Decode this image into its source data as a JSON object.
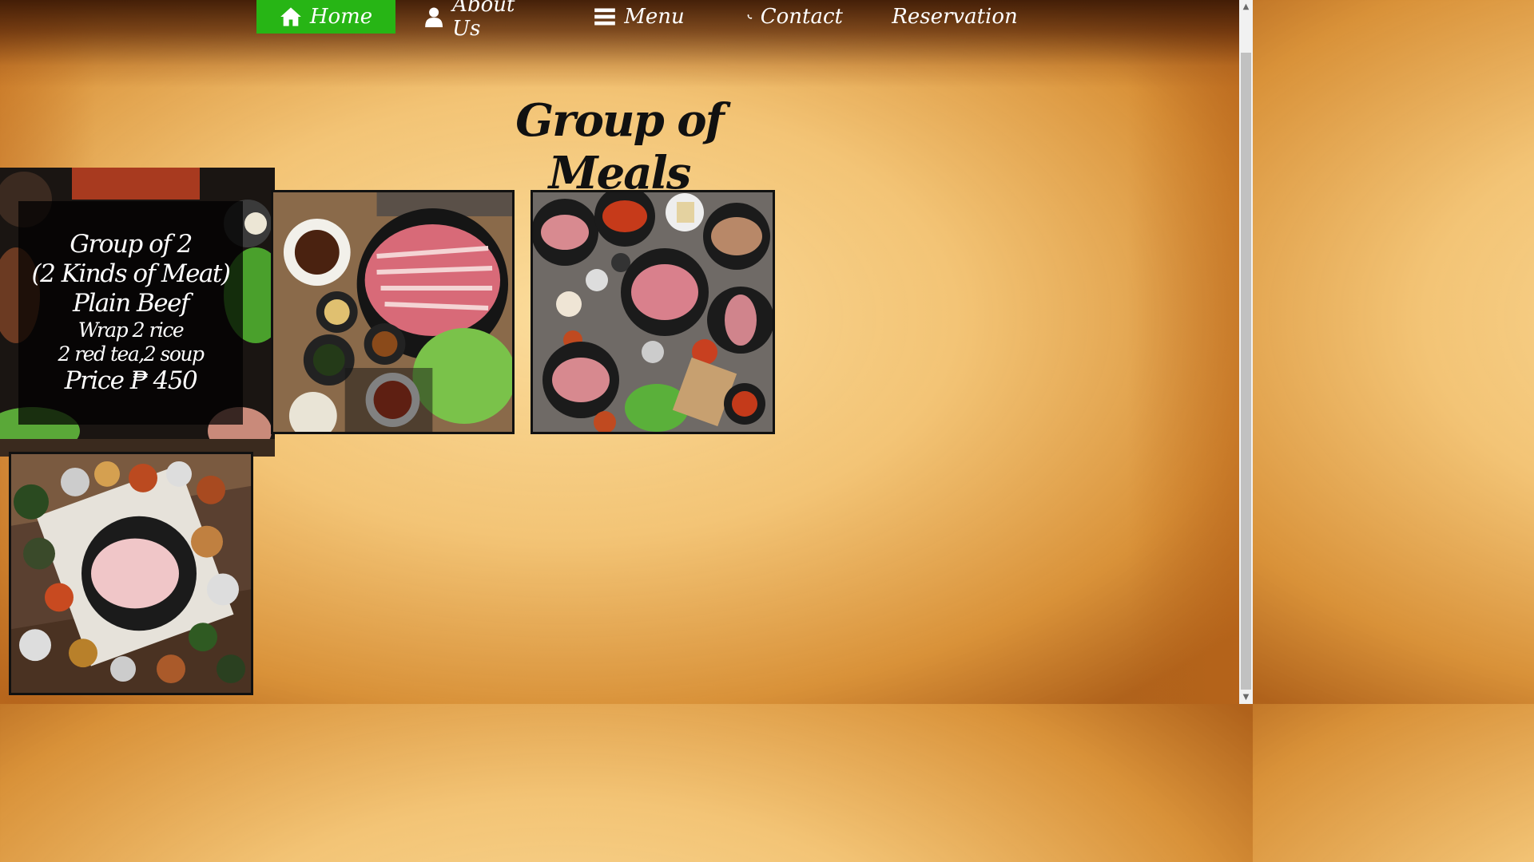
{
  "nav": {
    "items": [
      {
        "label": "Home",
        "icon": "home-icon",
        "active": true
      },
      {
        "label": "About Us",
        "icon": "user-icon",
        "active": false
      },
      {
        "label": "Menu",
        "icon": "bars-icon",
        "active": false
      },
      {
        "label": "Contact",
        "icon": "phone-icon",
        "active": false
      },
      {
        "label": "Reservation",
        "icon": "ticket-icon",
        "active": false
      }
    ],
    "active_color": "#27b515"
  },
  "page_title": "Group of Meals",
  "meals": [
    {
      "overlay_lines": [
        "Group of 2",
        "(2 Kinds of Meat)",
        "Plain Beef",
        "Wrap 2 rice",
        "2 red tea,2 soup",
        "Price ₱ 450"
      ]
    },
    {},
    {},
    {}
  ]
}
